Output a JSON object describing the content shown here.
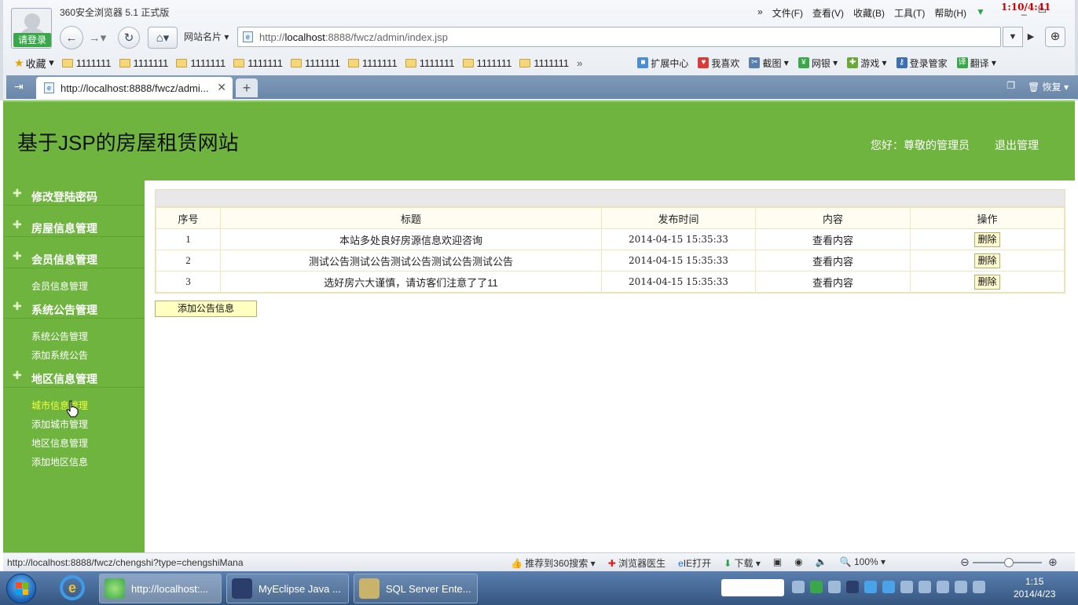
{
  "browser": {
    "login_label": "请登录",
    "app_title": "360安全浏览器 5.1 正式版",
    "menu": [
      "» ",
      "文件(F)",
      "查看(V)",
      "收藏(B)",
      "工具(T)",
      "帮助(H)"
    ],
    "clock_overlay": "1:10/4:41",
    "site_card_label": "网站名片 ▾",
    "address_prefix": "http://",
    "address_host": "localhost",
    "address_rest": ":8888/fwcz/admin/index.jsp",
    "favorites_label": "收藏",
    "bookmarks": [
      "1111111",
      "1111111",
      "1111111",
      "1111111",
      "1111111",
      "1111111",
      "1111111",
      "1111111",
      "1111111"
    ],
    "bookmarks_more": "»",
    "toolbar": {
      "extensions": "扩展中心",
      "likes": "我喜欢",
      "screenshot": "截图",
      "banking": "网银",
      "games": "游戏",
      "login_manager": "登录管家",
      "translate": "翻译"
    },
    "tab_title": "http://localhost:8888/fwcz/admi...",
    "restore_label": "恢复",
    "status_url": "http://localhost:8888/fwcz/chengshi?type=chengshiMana",
    "status": {
      "recommend": "推荐到360搜索",
      "doctor": "浏览器医生",
      "ie_open": "IE打开",
      "download": "下载",
      "zoom": "100%"
    }
  },
  "page": {
    "site_title": "基于JSP的房屋租赁网站",
    "greeting": "您好：尊敬的管理员",
    "logout": "退出管理",
    "sidebar": {
      "sections": [
        {
          "label": "修改登陆密码",
          "items": []
        },
        {
          "label": "房屋信息管理",
          "items": []
        },
        {
          "label": "会员信息管理",
          "items": [
            "会员信息管理"
          ]
        },
        {
          "label": "系统公告管理",
          "items": [
            "系统公告管理",
            "添加系统公告"
          ]
        },
        {
          "label": "地区信息管理",
          "items": [
            "城市信息管理",
            "添加城市管理",
            "地区信息管理",
            "添加地区信息"
          ]
        }
      ]
    },
    "table": {
      "columns": [
        "序号",
        "标题",
        "发布时间",
        "内容",
        "操作"
      ],
      "rows": [
        {
          "id": "1",
          "title": "本站多处良好房源信息欢迎咨询",
          "time": "2014-04-15 15:35:33",
          "content": "查看内容",
          "action": "删除"
        },
        {
          "id": "2",
          "title": "测试公告测试公告测试公告测试公告测试公告",
          "time": "2014-04-15 15:35:33",
          "content": "查看内容",
          "action": "删除"
        },
        {
          "id": "3",
          "title": "选好房六大谨慎，请访客们注意了了11",
          "time": "2014-04-15 15:35:33",
          "content": "查看内容",
          "action": "删除"
        }
      ]
    },
    "add_button": "添加公告信息"
  },
  "taskbar": {
    "tasks": [
      "http://localhost:...",
      "MyEclipse Java ...",
      "SQL Server Ente..."
    ],
    "time": "1:15",
    "date": "2014/4/23"
  },
  "colors": {
    "brand_green": "#6eb43f",
    "active_menu": "#f4ff3a",
    "table_border": "#efe6bf",
    "button_bg": "#ffffc2"
  }
}
